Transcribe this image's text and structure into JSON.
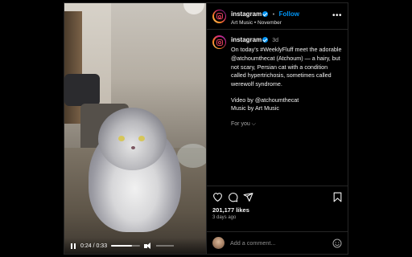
{
  "post": {
    "username": "instagram",
    "follow_label": "Follow",
    "audio_label": "Art Music • November",
    "more_label": "•••"
  },
  "video": {
    "time_display": "0:24 / 0:33",
    "progress": 0.727
  },
  "caption": {
    "username": "instagram",
    "time": "3d",
    "text": "On today’s #WeeklyFluff meet the adorable @atchoumthecat (Atchoum) — a hairy, but not scary, Persian cat with a condition called hypertrichosis, sometimes called werewolf syndrome.",
    "credit_line1": "Video by @atchoumthecat",
    "credit_line2": "Music by Art Music",
    "for_you": "For you ⌵"
  },
  "stats": {
    "likes": "201,177 likes",
    "posted_ago": "3 days ago"
  },
  "comment": {
    "placeholder": "Add a comment..."
  },
  "icons": {
    "heart": "heart-icon",
    "comment": "comment-icon",
    "share": "share-icon",
    "save": "bookmark-icon",
    "emoji": "emoji-icon"
  },
  "colors": {
    "accent": "#0095f6",
    "brand": "#e4405f"
  }
}
